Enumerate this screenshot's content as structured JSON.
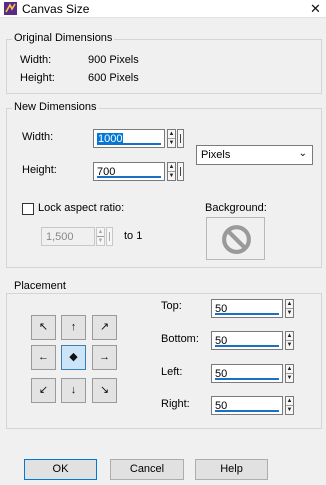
{
  "window": {
    "title": "Canvas Size",
    "close_glyph": "✕"
  },
  "original": {
    "legend": "Original Dimensions",
    "width_label": "Width:",
    "width_value": "900 Pixels",
    "height_label": "Height:",
    "height_value": "600 Pixels"
  },
  "new_dims": {
    "legend": "New Dimensions",
    "width_label": "Width:",
    "width_value": "1000",
    "height_label": "Height:",
    "height_value": "700",
    "units": "Pixels",
    "lock_label": "Lock aspect ratio:",
    "lock_checked": false,
    "ratio_value": "1,500",
    "ratio_suffix": "to 1",
    "background_label": "Background:"
  },
  "placement": {
    "legend": "Placement",
    "anchors": [
      "↖",
      "↑",
      "↗",
      "←",
      "◆",
      "→",
      "↙",
      "↓",
      "↘"
    ],
    "selected_anchor": "center",
    "top_label": "Top:",
    "top_value": "50",
    "bottom_label": "Bottom:",
    "bottom_value": "50",
    "left_label": "Left:",
    "left_value": "50",
    "right_label": "Right:",
    "right_value": "50"
  },
  "buttons": {
    "ok": "OK",
    "cancel": "Cancel",
    "help": "Help"
  },
  "colors": {
    "accent": "#1b6fc4",
    "focus": "#0078d7",
    "selected_anchor_bg": "#cce4f7"
  }
}
